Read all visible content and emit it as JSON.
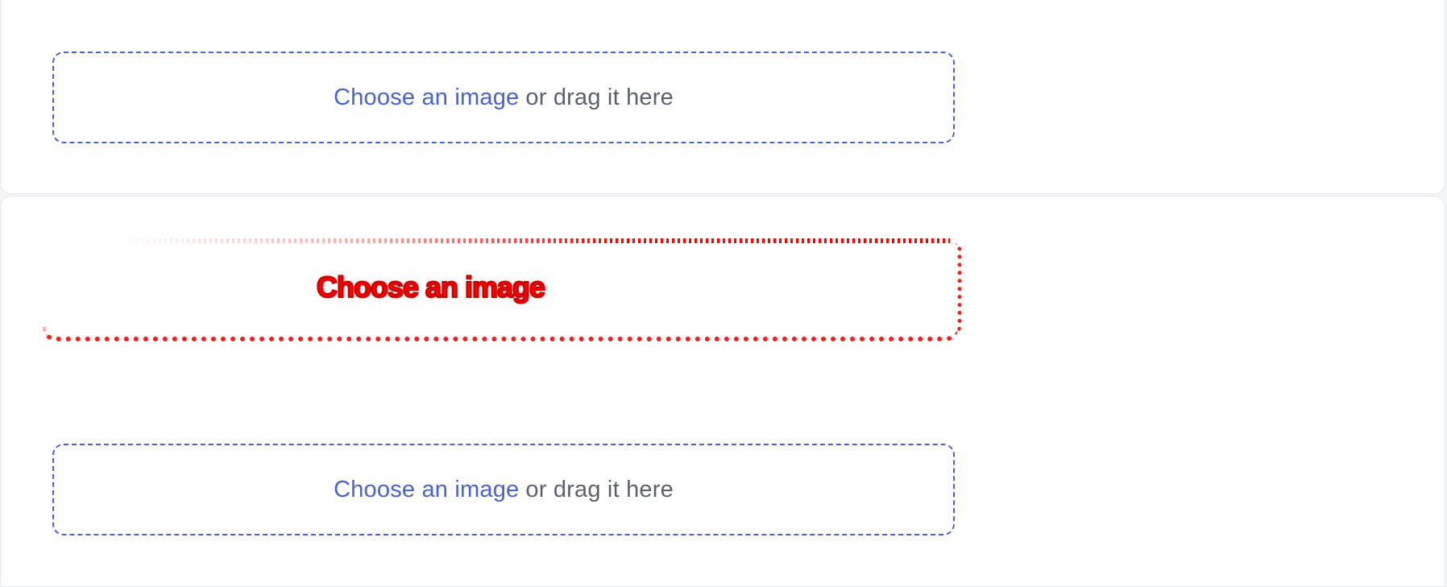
{
  "upload_fields": [
    {
      "choose_label": "Choose an image",
      "hint": "or drag it here"
    },
    {
      "choose_label": "Choose an image",
      "hint": ""
    },
    {
      "choose_label": "Choose an image",
      "hint": "or drag it here"
    }
  ],
  "colors": {
    "link": "#4a62c9",
    "hint_text": "#5b6170",
    "border": "#4a62c9",
    "error_red": "#ff0000",
    "card_bg": "#ffffff",
    "page_bg": "#f4f5f7"
  },
  "icons": []
}
